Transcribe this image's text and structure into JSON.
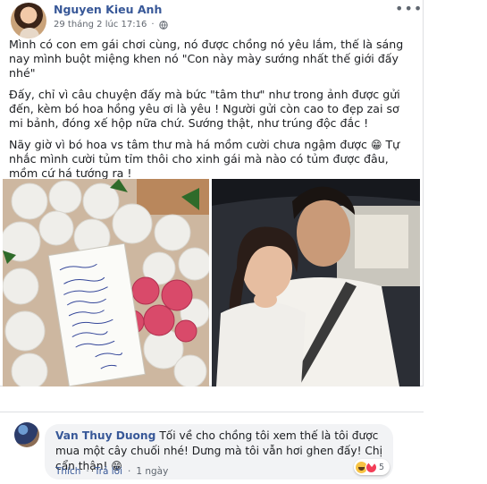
{
  "post": {
    "author": "Nguyen Kieu Anh",
    "timestamp": "29 tháng 2 lúc 17:16",
    "separator": "·",
    "privacy_icon": "globe-icon",
    "more_label": "•••",
    "paragraphs": [
      "Mình có con em gái chơi cùng, nó được chồng nó yêu lắm, thế là sáng nay mình buột miệng khen nó \"Con này mày sướng nhất thế giới đấy nhé\"",
      "Đấy, chỉ vì câu chuyện đấy mà bức \"tâm thư\" như trong ảnh được gửi đến, kèm bó hoa hồng yêu ơi là yêu ! Người gửi còn cao to đẹp zai sơ mi bảnh, đóng xế hộp nữa chứ. Sướng thật, như trúng độc đắc !",
      "Nãy giờ vì bó hoa vs tâm thư mà há mồm cười chưa ngậm được",
      "Tự nhắc mình cười tủm tỉm thôi cho xinh gái mà nào có tủm được đâu, mồm cứ há tướng ra !"
    ],
    "emoji_1": "😁"
  },
  "photos": {
    "note_lines": [
      "Dear Kim Anh,",
      "Anh thấy muốn",
      "em phải cảm ơn",
      "người xin...",
      "người ngoài",
      "đó",
      "e",
      "em chưa?",
      "để cho",
      "...",
      "cảm ơn",
      "Love you",
      "Chồng em"
    ]
  },
  "comment": {
    "author": "Van Thuy Duong",
    "text": "Tối về cho chồng tôi xem thế là tôi được mua một cây chuối nhé! Dưng mà tôi vẫn hơi ghen đấy! Chị cẩn thận!",
    "emoji": "😁",
    "reaction_count": "5",
    "actions": {
      "like": "Thích",
      "reply": "Trả lời",
      "sep": "·",
      "age": "1 ngày"
    }
  },
  "colors": {
    "link": "#385898",
    "bubble": "#f2f3f5",
    "muted": "#606770"
  }
}
